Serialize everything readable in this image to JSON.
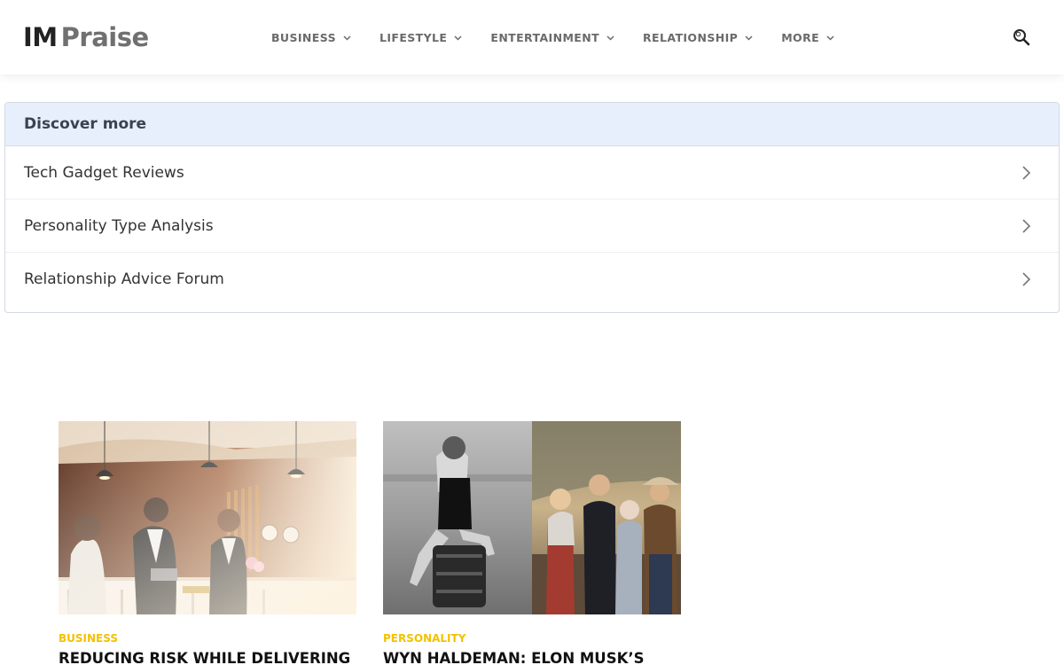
{
  "logo": {
    "part1": "IM",
    "part2": "Praise"
  },
  "nav": {
    "items": [
      {
        "label": "BUSINESS"
      },
      {
        "label": "LIFESTYLE"
      },
      {
        "label": "ENTERTAINMENT"
      },
      {
        "label": "RELATIONSHIP"
      },
      {
        "label": "MORE"
      }
    ],
    "search_icon": "search-icon"
  },
  "discover": {
    "title": "Discover more",
    "items": [
      {
        "label": "Tech Gadget Reviews"
      },
      {
        "label": "Personality Type Analysis"
      },
      {
        "label": "Relationship Advice Forum"
      }
    ]
  },
  "articles": [
    {
      "category": "BUSINESS",
      "title": "REDUCING RISK WHILE DELIVERING"
    },
    {
      "category": "PERSONALITY",
      "title": "WYN HALDEMAN: ELON MUSK’S"
    }
  ],
  "colors": {
    "accent": "#f2c200",
    "discover_header_bg": "#e7effc",
    "nav_text": "#6a6a6a"
  }
}
